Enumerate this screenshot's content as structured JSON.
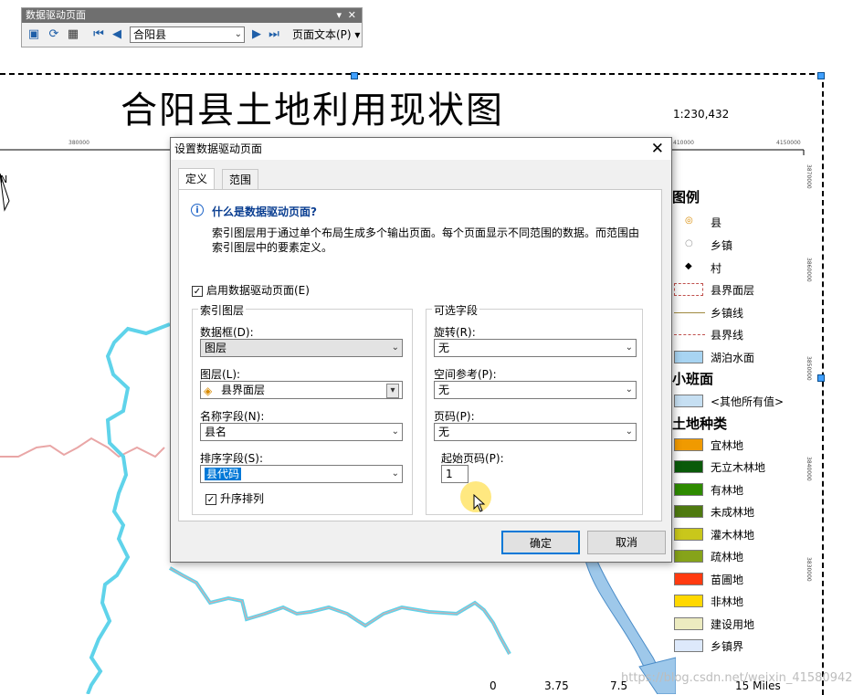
{
  "toolbar": {
    "title": "数据驱动页面",
    "page_value": "合阳县",
    "page_text_menu": "页面文本(P) ▾"
  },
  "map": {
    "title": "合阳县土地利用现状图",
    "scale": "1:230,432",
    "scalebar_labels": [
      "0",
      "3.75",
      "7.5",
      "15 Miles"
    ],
    "north_label": "N"
  },
  "legend": {
    "title": "图例",
    "items": [
      {
        "label": "县",
        "kind": "point",
        "color": "#d88a00"
      },
      {
        "label": "乡镇",
        "kind": "point",
        "color": "#999999"
      },
      {
        "label": "村",
        "kind": "point",
        "color": "#000000"
      },
      {
        "label": "县界面层",
        "kind": "polygon",
        "color": "#ffffff",
        "border": "#c0504d"
      },
      {
        "label": "乡镇线",
        "kind": "line",
        "color": "#a08a40"
      },
      {
        "label": "县界线",
        "kind": "line",
        "color": "#c0504d"
      },
      {
        "label": "湖泊水面",
        "kind": "polygon",
        "color": "#a8d4f2"
      }
    ],
    "sub_head_1": "小班面",
    "sub_items_1": [
      {
        "label": "<其他所有值>",
        "color": "#c6dff2"
      }
    ],
    "sub_head_2": "土地种类",
    "sub_items_2": [
      {
        "label": "宜林地",
        "color": "#f09a00"
      },
      {
        "label": "无立木林地",
        "color": "#0a5a0a"
      },
      {
        "label": "有林地",
        "color": "#2e8b00"
      },
      {
        "label": "未成林地",
        "color": "#4f7a10"
      },
      {
        "label": "灌木林地",
        "color": "#c9c71b"
      },
      {
        "label": "疏林地",
        "color": "#86a31a"
      },
      {
        "label": "苗圃地",
        "color": "#ff3a10"
      },
      {
        "label": "非林地",
        "color": "#ffd800"
      },
      {
        "label": "建设用地",
        "color": "#ecebc0"
      },
      {
        "label": "乡镇界",
        "color": "#dde9fb"
      }
    ]
  },
  "dialog": {
    "title": "设置数据驱动页面",
    "close": "✕",
    "tabs": [
      "定义",
      "范围"
    ],
    "info_title": "什么是数据驱动页面?",
    "info_desc": "索引图层用于通过单个布局生成多个输出页面。每个页面显示不同范围的数据。而范围由索引图层中的要素定义。",
    "enable_label": "启用数据驱动页面(E)",
    "index_group": "索引图层",
    "data_frame_label": "数据框(D):",
    "data_frame_value": "图层",
    "layer_label": "图层(L):",
    "layer_value": "县界面层",
    "name_field_label": "名称字段(N):",
    "name_field_value": "县名",
    "sort_field_label": "排序字段(S):",
    "sort_field_value": "县代码",
    "ascending_label": "升序排列",
    "optional_group": "可选字段",
    "rotation_label": "旋转(R):",
    "rotation_value": "无",
    "spatial_ref_label": "空间参考(P):",
    "spatial_ref_value": "无",
    "page_number_label": "页码(P):",
    "page_number_value": "无",
    "start_page_label": "起始页码(P):",
    "start_page_value": "1",
    "ok": "确定",
    "cancel": "取消"
  },
  "watermark": "https://blog.csdn.net/weixin_41580942"
}
